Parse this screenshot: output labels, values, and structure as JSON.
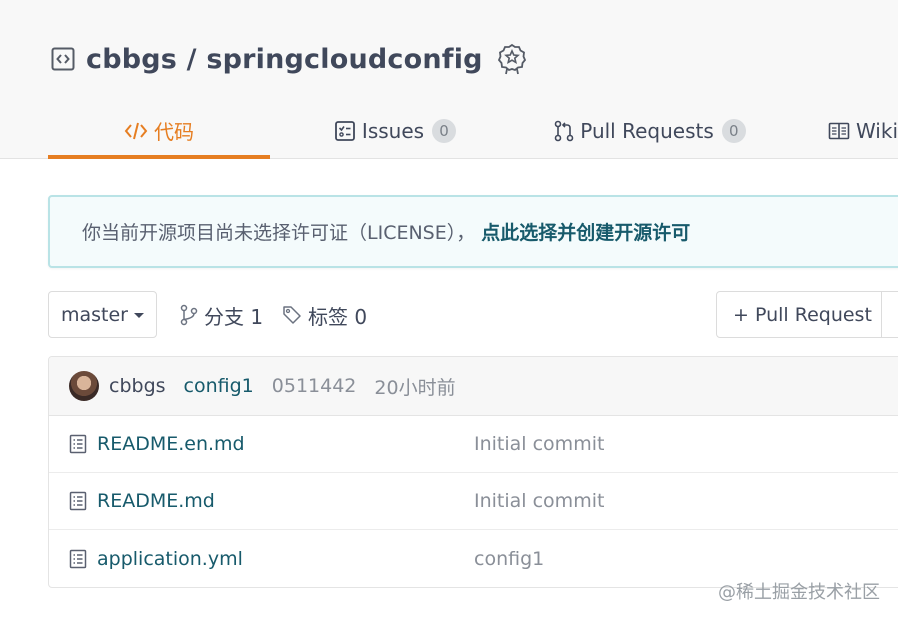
{
  "repo": {
    "title": "cbbgs / springcloudconfig"
  },
  "tabs": [
    {
      "label": "代码",
      "count": null,
      "active": true
    },
    {
      "label": "Issues",
      "count": "0",
      "active": false
    },
    {
      "label": "Pull Requests",
      "count": "0",
      "active": false
    },
    {
      "label": "Wiki",
      "count": null,
      "active": false
    }
  ],
  "license_notice": {
    "message": "你当前开源项目尚未选择许可证（LICENSE），",
    "link": "点此选择并创建开源许可"
  },
  "branch": {
    "selected": "master",
    "branches_label": "分支 1",
    "tags_label": "标签 0",
    "pull_request_button": "+ Pull Request"
  },
  "latest_commit": {
    "author": "cbbgs",
    "message": "config1",
    "sha": "0511442",
    "time": "20小时前"
  },
  "files": [
    {
      "name": "README.en.md",
      "commit": "Initial commit"
    },
    {
      "name": "README.md",
      "commit": "Initial commit"
    },
    {
      "name": "application.yml",
      "commit": "config1"
    }
  ],
  "watermark": "@稀土掘金技术社区",
  "colors": {
    "accent": "#e67e22",
    "link": "#175a6b",
    "text": "#40485b",
    "muted": "#8a8f98"
  }
}
